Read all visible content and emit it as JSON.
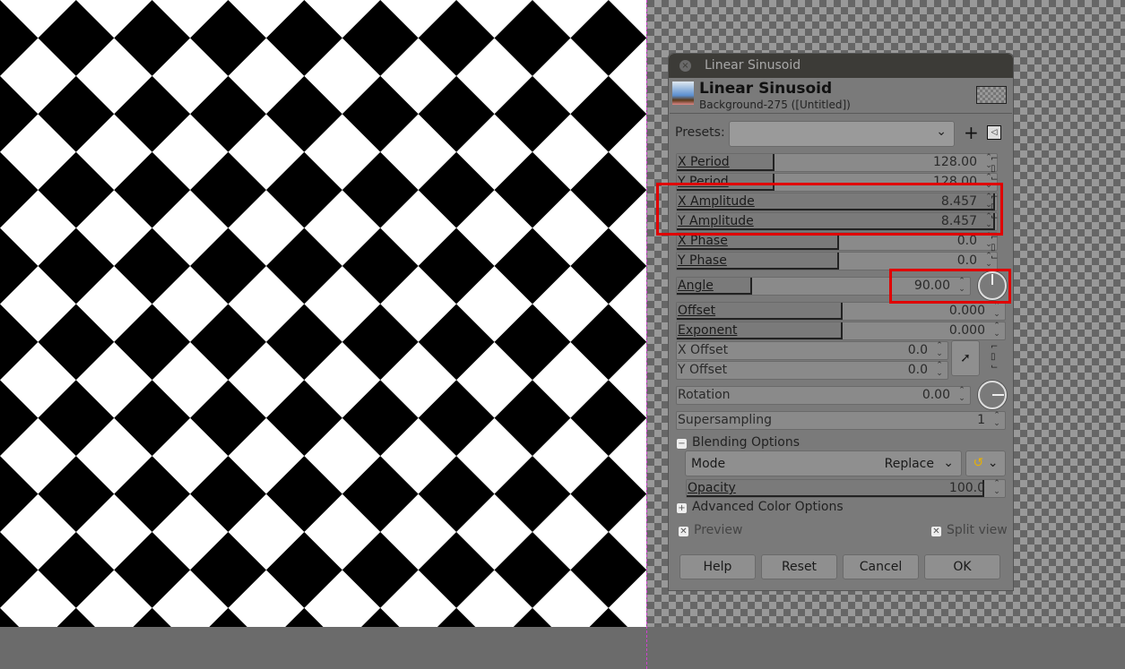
{
  "dialog": {
    "window_title": "Linear Sinusoid",
    "title": "Linear Sinusoid",
    "subtitle": "Background-275 ([Untitled])"
  },
  "presets": {
    "label": "Presets:",
    "value": "",
    "add": "+",
    "menu": "◁"
  },
  "params": [
    {
      "label": "X Period",
      "value": "128.00",
      "fill": 0.3
    },
    {
      "label": "Y Period",
      "value": "128.00",
      "fill": 0.3
    },
    {
      "label": "X Amplitude",
      "value": "8.457",
      "fill": 0.99
    },
    {
      "label": "Y Amplitude",
      "value": "8.457",
      "fill": 0.99
    },
    {
      "label": "X Phase",
      "value": "0.0",
      "fill": 0.5
    },
    {
      "label": "Y Phase",
      "value": "0.0",
      "fill": 0.5
    },
    {
      "label": "Angle",
      "value": "90.00",
      "fill": 0.25
    },
    {
      "label": "Offset",
      "value": "0.000",
      "fill": 0.5
    },
    {
      "label": "Exponent",
      "value": "0.000",
      "fill": 0.5
    },
    {
      "label": "X Offset",
      "value": "0.0"
    },
    {
      "label": "Y Offset",
      "value": "0.0"
    },
    {
      "label": "Rotation",
      "value": "0.00"
    },
    {
      "label": "Supersampling",
      "value": "1"
    }
  ],
  "blending": {
    "header": "Blending Options",
    "mode_label": "Mode",
    "mode_value": "Replace",
    "opacity_label": "Opacity",
    "opacity_value": "100.0"
  },
  "advanced": "Advanced Color Options",
  "preview": "Preview",
  "split_view": "Split view",
  "buttons": {
    "help": "Help",
    "reset": "Reset",
    "cancel": "Cancel",
    "ok": "OK"
  }
}
